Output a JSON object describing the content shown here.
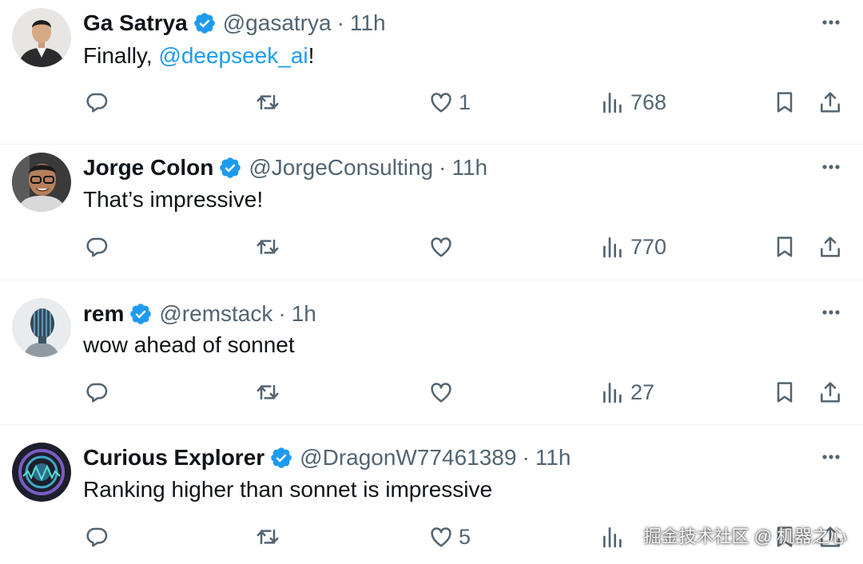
{
  "tweets": [
    {
      "name": "Ga Satrya",
      "handle": "@gasatrya",
      "time": "11h",
      "text_before": "Finally, ",
      "mention": "@deepseek_ai",
      "text_after": "!",
      "avatar_icon": "person-photo-suit",
      "stats": {
        "replies": "",
        "retweets": "",
        "likes": "1",
        "views": "768"
      }
    },
    {
      "name": "Jorge Colon",
      "handle": "@JorgeConsulting",
      "time": "11h",
      "text_before": "That’s impressive!",
      "mention": "",
      "text_after": "",
      "avatar_icon": "person-photo-glasses",
      "stats": {
        "replies": "",
        "retweets": "",
        "likes": "",
        "views": "770"
      }
    },
    {
      "name": "rem",
      "handle": "@remstack",
      "time": "1h",
      "text_before": "wow ahead of sonnet",
      "mention": "",
      "text_after": "",
      "avatar_icon": "robot-head-profile",
      "stats": {
        "replies": "",
        "retweets": "",
        "likes": "",
        "views": "27"
      }
    },
    {
      "name": "Curious Explorer",
      "handle": "@DragonW77461389",
      "time": "11h",
      "text_before": "Ranking higher than sonnet is impressive",
      "mention": "",
      "text_after": "",
      "avatar_icon": "circular-emblem",
      "stats": {
        "replies": "",
        "retweets": "",
        "likes": "5",
        "views": ""
      }
    }
  ],
  "separator": "·",
  "watermark": "掘金技术社区 @ 机器之心",
  "colors": {
    "text": "#0f1419",
    "secondary": "#536471",
    "accent": "#1d9bf0",
    "divider": "#eff3f4"
  }
}
